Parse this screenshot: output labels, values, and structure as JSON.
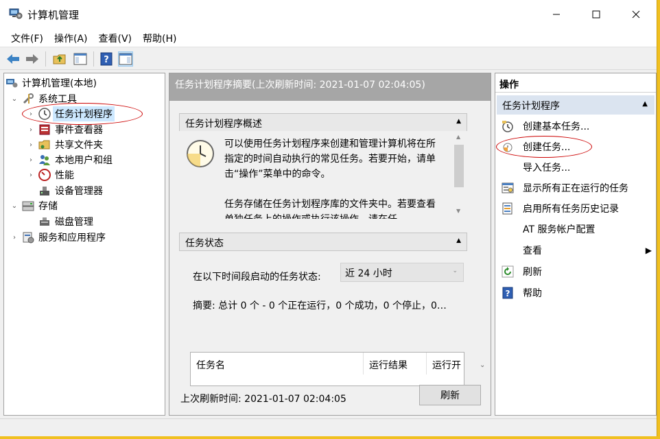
{
  "window": {
    "title": "计算机管理",
    "controls": {
      "minimize": "minimize-icon",
      "maximize": "maximize-icon",
      "close": "close-icon"
    }
  },
  "menu": [
    "文件(F)",
    "操作(A)",
    "查看(V)",
    "帮助(H)"
  ],
  "toolbar": [
    "back-arrow-icon",
    "forward-arrow-icon",
    "up-folder-icon",
    "show-hide-tree-icon",
    "help-icon",
    "show-action-pane-icon"
  ],
  "tree": {
    "root": "计算机管理(本地)",
    "items": [
      {
        "label": "系统工具",
        "icon": "tools-icon",
        "expanded": true
      },
      {
        "label": "任务计划程序",
        "icon": "clock-icon",
        "selected": true
      },
      {
        "label": "事件查看器",
        "icon": "event-viewer-icon"
      },
      {
        "label": "共享文件夹",
        "icon": "shared-folder-icon"
      },
      {
        "label": "本地用户和组",
        "icon": "users-icon"
      },
      {
        "label": "性能",
        "icon": "performance-icon"
      },
      {
        "label": "设备管理器",
        "icon": "device-manager-icon"
      },
      {
        "label": "存储",
        "icon": "storage-icon",
        "expanded": true
      },
      {
        "label": "磁盘管理",
        "icon": "disk-icon"
      },
      {
        "label": "服务和应用程序",
        "icon": "services-icon"
      }
    ]
  },
  "middle": {
    "header": "任务计划程序摘要(上次刷新时间: 2021-01-07 02:04:05)",
    "overview": {
      "title": "任务计划程序概述",
      "para1": "可以使用任务计划程序来创建和管理计算机将在所指定的时间自动执行的常见任务。若要开始，请单击“操作”菜单中的命令。",
      "para2": "任务存储在任务计划程序库的文件夹中。若要查看单独任务上的操作或执行该操作，请在任"
    },
    "status": {
      "title": "任务状态",
      "prompt": "在以下时间段启动的任务状态:",
      "period": "近 24 小时",
      "summary": "摘要: 总计 0 个 - 0 个正在运行，0 个成功，0 个停止，0…",
      "columns": [
        "任务名",
        "运行结果",
        "运行开"
      ]
    },
    "footer": {
      "last_refresh": "上次刷新时间: 2021-01-07 02:04:05",
      "refresh_button": "刷新"
    }
  },
  "actions": {
    "title": "操作",
    "section": "任务计划程序",
    "items": [
      {
        "label": "创建基本任务...",
        "icon": "create-basic-task-icon"
      },
      {
        "label": "创建任务...",
        "icon": "create-task-icon"
      },
      {
        "label": "导入任务...",
        "icon": ""
      },
      {
        "label": "显示所有正在运行的任务",
        "icon": "running-tasks-icon"
      },
      {
        "label": "启用所有任务历史记录",
        "icon": "history-icon"
      },
      {
        "label": "AT 服务帐户配置",
        "icon": ""
      },
      {
        "label": "查看",
        "icon": "",
        "submenu": true
      },
      {
        "label": "刷新",
        "icon": "refresh-icon"
      },
      {
        "label": "帮助",
        "icon": "help-icon"
      }
    ]
  },
  "colors": {
    "selection": "#cce8ff",
    "accent_annotation": "#cc0000",
    "header_gray": "#a6a6a6",
    "action_section_bg": "#dbe4f0"
  }
}
